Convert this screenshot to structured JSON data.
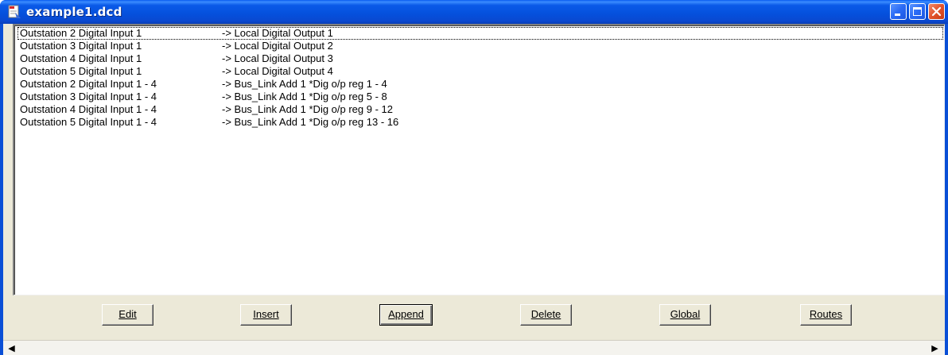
{
  "window": {
    "title": "example1.dcd"
  },
  "list": {
    "rows": [
      {
        "source": "Outstation 2 Digital Input 1",
        "target": "-> Local Digital Output 1"
      },
      {
        "source": "Outstation 3 Digital Input 1",
        "target": "-> Local Digital Output 2"
      },
      {
        "source": "Outstation 4 Digital Input 1",
        "target": "-> Local Digital Output 3"
      },
      {
        "source": "Outstation 5 Digital Input 1",
        "target": "-> Local Digital Output 4"
      },
      {
        "source": "Outstation 2 Digital Input 1 - 4",
        "target": "-> Bus_Link Add 1 *Dig o/p reg 1 - 4"
      },
      {
        "source": "Outstation 3 Digital Input 1 - 4",
        "target": "-> Bus_Link Add 1 *Dig o/p reg 5 - 8"
      },
      {
        "source": "Outstation 4 Digital Input 1 - 4",
        "target": "-> Bus_Link Add 1 *Dig o/p reg 9 - 12"
      },
      {
        "source": "Outstation 5 Digital Input 1 - 4",
        "target": "-> Bus_Link Add 1 *Dig o/p reg 13 - 16"
      }
    ]
  },
  "buttons": {
    "edit": "Edit",
    "insert": "Insert",
    "append": "Append",
    "delete": "Delete",
    "global": "Global",
    "routes": "Routes"
  },
  "icons": {
    "app": "document-icon",
    "minimize": "minimize-icon",
    "maximize": "maximize-icon",
    "close": "close-icon",
    "scroll_left": "arrow-left-icon",
    "scroll_right": "arrow-right-icon"
  },
  "colors": {
    "titlebar": "#0550dc",
    "close_button": "#e2542c",
    "dialog_face": "#ece9d8"
  }
}
